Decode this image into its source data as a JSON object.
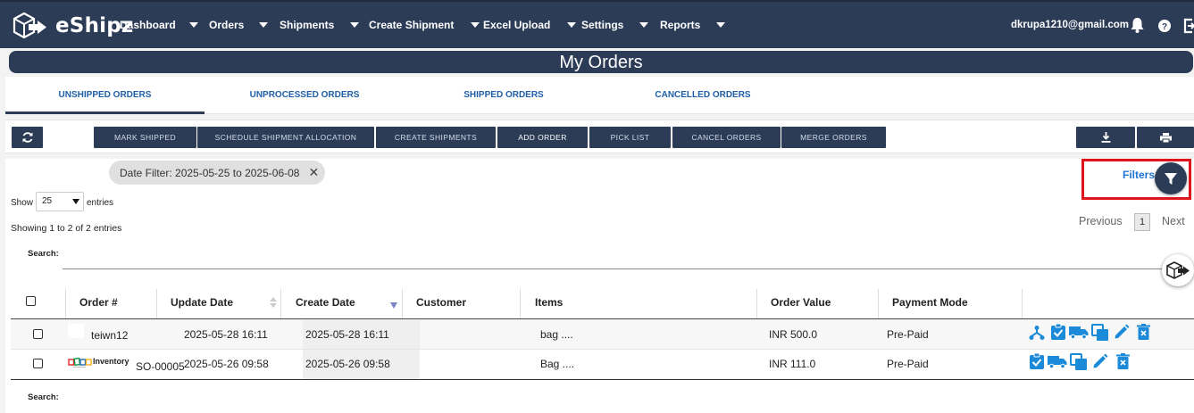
{
  "brand": {
    "name": "eShipz"
  },
  "nav": {
    "items": [
      "Dashboard",
      "Orders",
      "Shipments",
      "Create Shipment",
      "Excel Upload",
      "Settings",
      "Reports"
    ],
    "email": "dkrupa1210@gmail.com"
  },
  "page": {
    "title": "My Orders"
  },
  "tabs": [
    "UNSHIPPED ORDERS",
    "UNPROCESSED ORDERS",
    "SHIPPED ORDERS",
    "CANCELLED ORDERS"
  ],
  "toolbar": {
    "buttons": [
      "MARK SHIPPED",
      "SCHEDULE SHIPMENT ALLOCATION",
      "CREATE SHIPMENTS",
      "ADD ORDER",
      "PICK LIST",
      "CANCEL ORDERS",
      "MERGE ORDERS"
    ]
  },
  "filter": {
    "chip": "Date Filter: 2025-05-25 to 2025-06-08",
    "chip_close": "✕",
    "filters_label": "Filters"
  },
  "entries": {
    "show_label": "Show",
    "value": "25",
    "suffix": "entries",
    "info": "Showing 1 to 2 of 2 entries"
  },
  "pagination": {
    "previous": "Previous",
    "page": "1",
    "next": "Next"
  },
  "search": {
    "label": "Search:"
  },
  "table": {
    "headers": [
      "Order #",
      "Update Date",
      "Create Date",
      "Customer",
      "Items",
      "Order Value",
      "Payment Mode"
    ],
    "rows": [
      {
        "order": "teiwn12",
        "source": "",
        "update": "2025-05-28 16:11",
        "create": "2025-05-28 16:11",
        "customer": "",
        "items": "bag ....",
        "value": "INR 500.0",
        "payment": "Pre-Paid"
      },
      {
        "order": "SO-00005",
        "source": "Inventory",
        "update": "2025-05-26 09:58",
        "create": "2025-05-26 09:58",
        "customer": "",
        "items": "Bag ....",
        "value": "INR 111.0",
        "payment": "Pre-Paid"
      }
    ]
  },
  "footer": {
    "search_label": "Search:"
  },
  "colors": {
    "navy": "#2c3c57",
    "link": "#1f74d6",
    "action_icon": "#1b8ad8",
    "highlight": "#e0151b"
  }
}
